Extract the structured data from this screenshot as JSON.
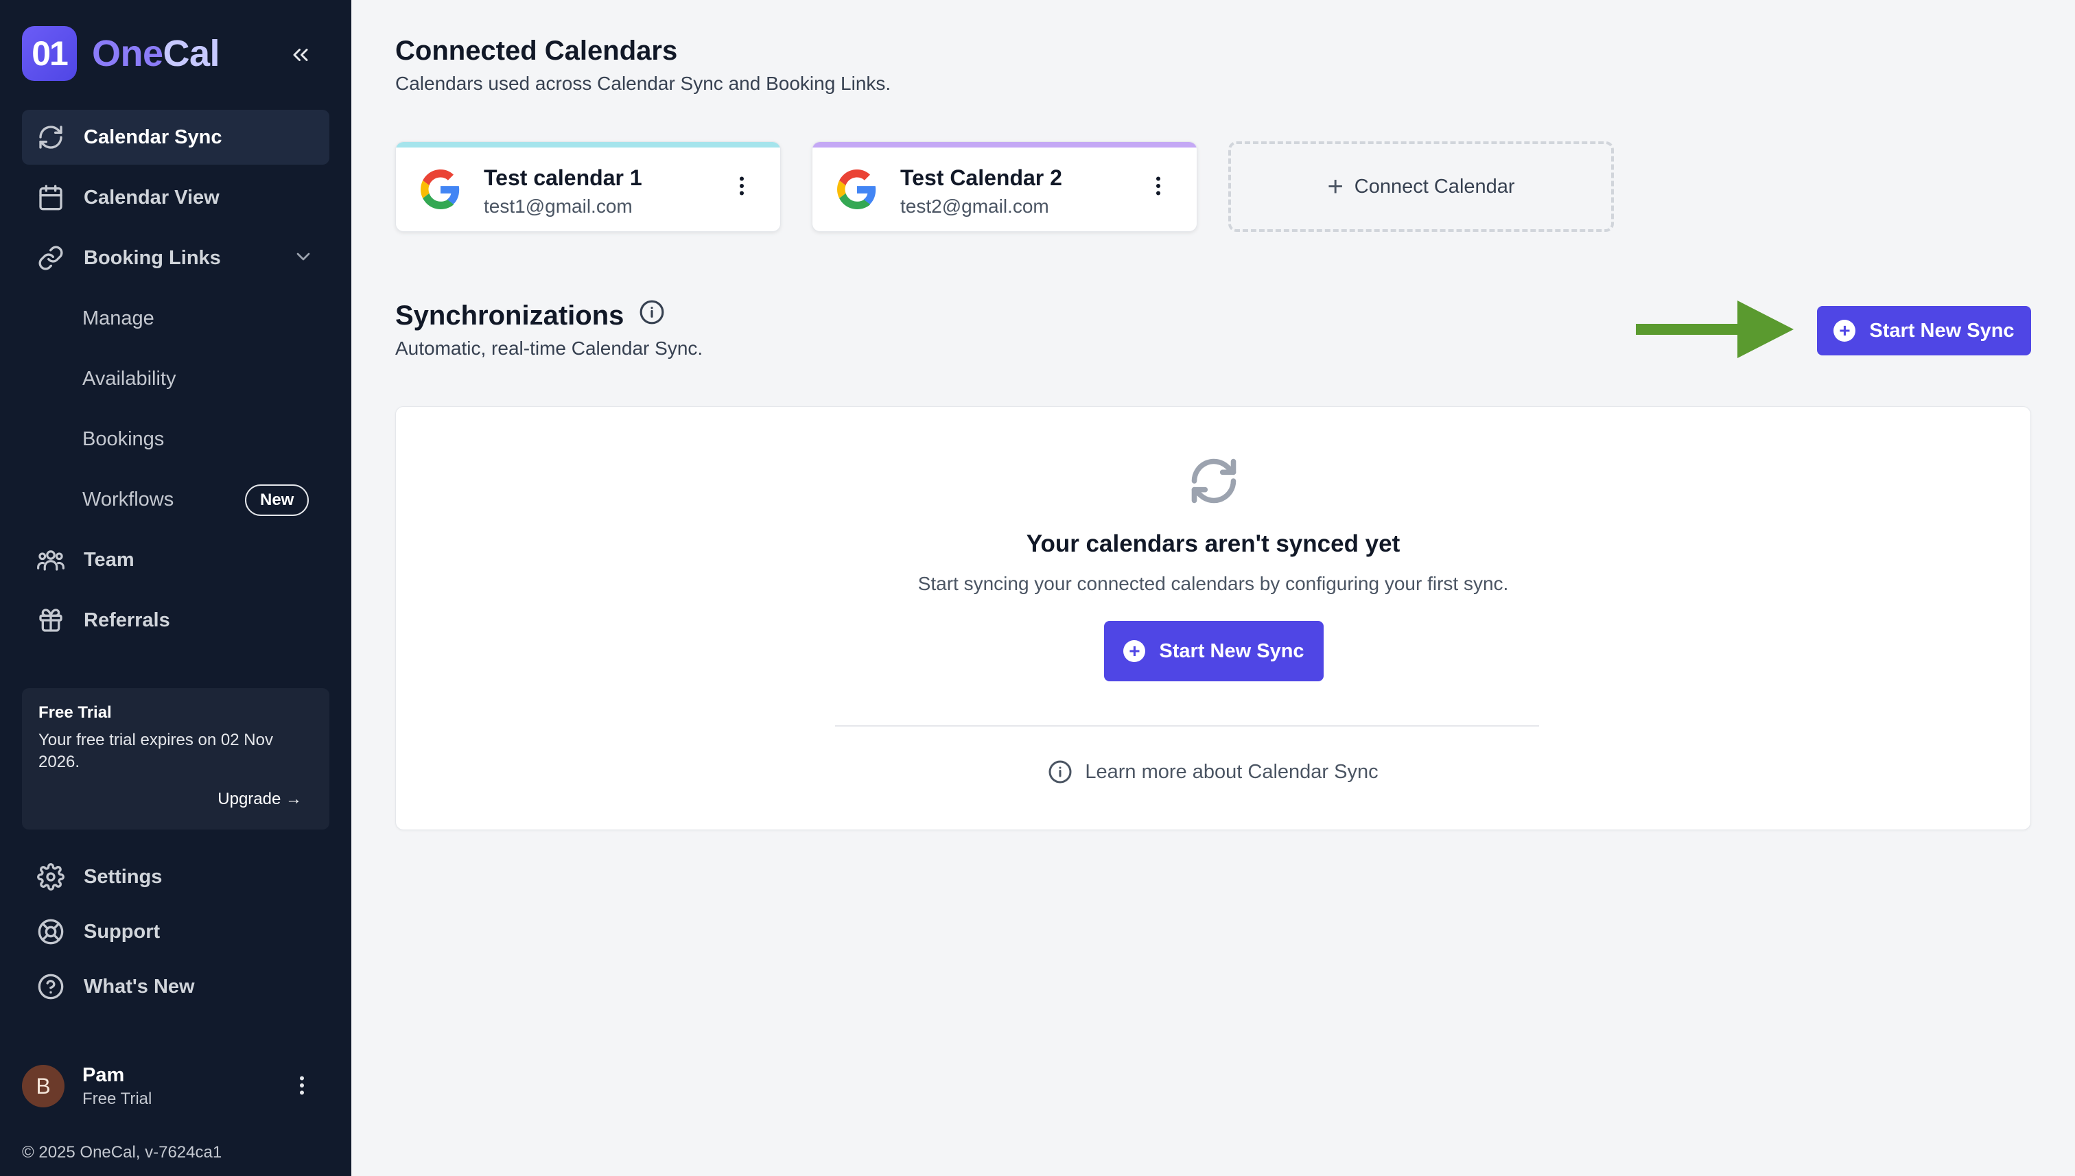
{
  "brand": {
    "logo_mark": "01",
    "name_part1": "One",
    "name_part2": "Cal"
  },
  "sidebar": {
    "items": [
      {
        "label": "Calendar Sync",
        "icon": "sync-icon",
        "active": true
      },
      {
        "label": "Calendar View",
        "icon": "calendar-icon"
      },
      {
        "label": "Booking Links",
        "icon": "link-icon"
      }
    ],
    "sub_items": [
      {
        "label": "Manage"
      },
      {
        "label": "Availability"
      },
      {
        "label": "Bookings"
      },
      {
        "label": "Workflows",
        "badge": "New"
      }
    ],
    "items2": [
      {
        "label": "Team",
        "icon": "team-icon"
      },
      {
        "label": "Referrals",
        "icon": "gift-icon"
      }
    ],
    "trial": {
      "title": "Free Trial",
      "text": "Your free trial expires on 02 Nov 2026.",
      "upgrade": "Upgrade →"
    },
    "bottom_items": [
      {
        "label": "Settings",
        "icon": "gear-icon"
      },
      {
        "label": "Support",
        "icon": "lifebuoy-icon"
      },
      {
        "label": "What's New",
        "icon": "question-icon"
      }
    ],
    "user": {
      "initial": "B",
      "name": "Pam",
      "plan": "Free Trial"
    },
    "footer": "© 2025 OneCal, v-7624ca1"
  },
  "main": {
    "connected": {
      "title": "Connected Calendars",
      "subtitle": "Calendars used across Calendar Sync and Booking Links.",
      "calendars": [
        {
          "name": "Test calendar 1",
          "email": "test1@gmail.com",
          "accent": "#a5e4ec"
        },
        {
          "name": "Test Calendar 2",
          "email": "test2@gmail.com",
          "accent": "#c4a8f5"
        }
      ],
      "connect_label": "Connect Calendar"
    },
    "sync": {
      "title": "Synchronizations",
      "subtitle": "Automatic, real-time Calendar Sync.",
      "start_label": "Start New Sync",
      "empty_title": "Your calendars aren't synced yet",
      "empty_desc": "Start syncing your connected calendars by configuring your first sync.",
      "empty_button": "Start New Sync",
      "learn_more": "Learn more about Calendar Sync"
    }
  },
  "colors": {
    "primary": "#4f46e5",
    "sidebar_bg": "#111a2c",
    "arrow": "#5a9a2f"
  }
}
